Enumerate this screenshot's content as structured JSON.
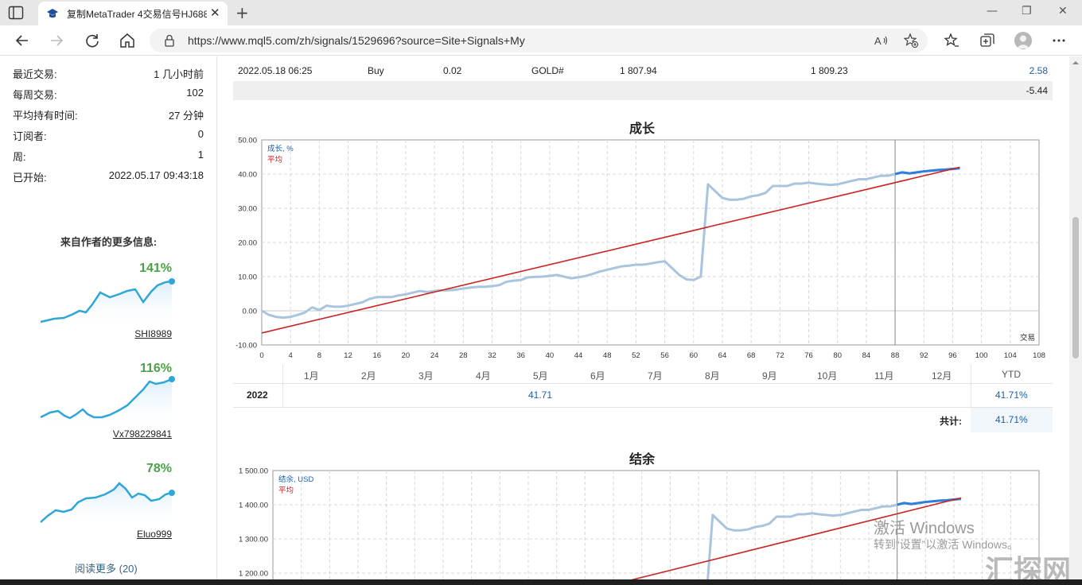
{
  "browser": {
    "tab_title": "复制MetaTrader 4交易信号HJ688",
    "url": "https://www.mql5.com/zh/signals/1529696?source=Site+Signals+My"
  },
  "stats": [
    {
      "label": "最近交易:",
      "value": "1 几小时前"
    },
    {
      "label": "每周交易:",
      "value": "102"
    },
    {
      "label": "平均持有时间:",
      "value": "27 分钟"
    },
    {
      "label": "订阅者:",
      "value": "0"
    },
    {
      "label": "周:",
      "value": "1"
    },
    {
      "label": "已开始:",
      "value": "2022.05.17 09:43:18"
    }
  ],
  "author": {
    "title": "来自作者的更多信息:",
    "signals": [
      {
        "name": "SHI8989",
        "growth": "141%"
      },
      {
        "name": "Vx798229841",
        "growth": "116%"
      },
      {
        "name": "Eluo999",
        "growth": "78%"
      }
    ],
    "read_more": "阅读更多 (20)"
  },
  "trade": {
    "time": "2022.05.18 06:25",
    "type": "Buy",
    "volume": "0.02",
    "symbol": "GOLD#",
    "open_price": "1 807.94",
    "close_price": "1 809.23",
    "profit": "2.58",
    "total": "-5.44"
  },
  "growth_chart": {
    "title": "成长",
    "legend_main": "成长, %",
    "legend_avg": "平均",
    "x_axis_label": "交易"
  },
  "months_table": {
    "months": [
      "1月",
      "2月",
      "3月",
      "4月",
      "5月",
      "6月",
      "7月",
      "8月",
      "9月",
      "10月",
      "11月",
      "12月"
    ],
    "ytd_header": "YTD",
    "year": "2022",
    "may_value": "41.71",
    "ytd_value": "41.71%",
    "total_label": "共计:",
    "total_value": "41.71%"
  },
  "balance_chart": {
    "title": "结余",
    "legend_main": "结余, USD",
    "legend_avg": "平均"
  },
  "watermark": {
    "line1": "激活 Windows",
    "line2": "转到“设置”以激活 Windows。",
    "logo": "汇探网"
  },
  "colors": {
    "growth_line": "#a9c5de",
    "growth_line_recent": "#2f7ed8",
    "average_line": "#cc2222",
    "positive": "#4aa147",
    "link_blue": "#1d5fa8"
  },
  "chart_data": [
    {
      "type": "line",
      "title": "成长",
      "xlabel": "交易",
      "ylabel": "",
      "xlim": [
        0,
        108
      ],
      "ylim": [
        -10,
        50
      ],
      "x_ticks": [
        0,
        4,
        8,
        12,
        16,
        20,
        24,
        28,
        32,
        36,
        40,
        44,
        48,
        52,
        56,
        60,
        64,
        68,
        72,
        76,
        80,
        84,
        88,
        92,
        96,
        100,
        104,
        108
      ],
      "y_ticks": [
        -10,
        0,
        10,
        20,
        30,
        40,
        50
      ],
      "grid": true,
      "series": [
        {
          "name": "成长, %",
          "x": [
            0,
            1,
            2,
            3,
            4,
            5,
            6,
            7,
            8,
            9,
            10,
            11,
            12,
            13,
            14,
            15,
            16,
            17,
            18,
            19,
            20,
            21,
            22,
            23,
            24,
            25,
            26,
            27,
            28,
            29,
            30,
            31,
            32,
            33,
            34,
            35,
            36,
            37,
            38,
            39,
            40,
            41,
            42,
            43,
            44,
            45,
            46,
            47,
            48,
            49,
            50,
            51,
            52,
            53,
            54,
            55,
            56,
            57,
            58,
            59,
            60,
            61,
            62,
            63,
            64,
            65,
            66,
            67,
            68,
            69,
            70,
            71,
            72,
            73,
            74,
            75,
            76,
            77,
            78,
            79,
            80,
            81,
            82,
            83,
            84,
            85,
            86,
            87,
            88,
            89,
            90,
            91,
            92,
            93,
            94,
            95,
            96,
            97
          ],
          "y": [
            0,
            -1.2,
            -1.8,
            -2.0,
            -1.8,
            -1.2,
            -0.5,
            1.0,
            0.2,
            1.5,
            1.2,
            1.2,
            1.5,
            2.0,
            2.5,
            3.5,
            4.0,
            4.0,
            4.0,
            4.5,
            4.8,
            5.3,
            5.8,
            5.5,
            5.8,
            6.0,
            6.0,
            6.2,
            6.5,
            6.8,
            7.0,
            7.0,
            7.2,
            7.5,
            8.5,
            8.8,
            9.0,
            9.8,
            9.9,
            10.0,
            10.2,
            10.5,
            10.0,
            9.5,
            9.8,
            10.2,
            10.8,
            11.5,
            12.0,
            12.5,
            13.0,
            13.2,
            13.5,
            13.5,
            13.8,
            14.2,
            14.5,
            12.5,
            10.5,
            9.2,
            9.0,
            10.0,
            37.0,
            35.0,
            33.0,
            32.5,
            32.5,
            32.8,
            33.5,
            33.8,
            34.5,
            36.5,
            36.5,
            36.5,
            37.2,
            37.2,
            37.5,
            37.2,
            37.0,
            36.8,
            37.0,
            37.5,
            38.0,
            38.5,
            38.5,
            39.0,
            39.5,
            39.5,
            40.0,
            40.5,
            40.2,
            40.5,
            40.8,
            41.0,
            41.2,
            41.3,
            41.5,
            41.7
          ]
        },
        {
          "name": "平均",
          "x": [
            0,
            97
          ],
          "y": [
            -6.5,
            42.0
          ]
        }
      ]
    },
    {
      "type": "line",
      "title": "结余",
      "ylim": [
        1200,
        1500
      ],
      "y_ticks": [
        1200,
        1300,
        1400,
        1500
      ],
      "series": [
        {
          "name": "结余, USD"
        },
        {
          "name": "平均"
        }
      ]
    }
  ]
}
